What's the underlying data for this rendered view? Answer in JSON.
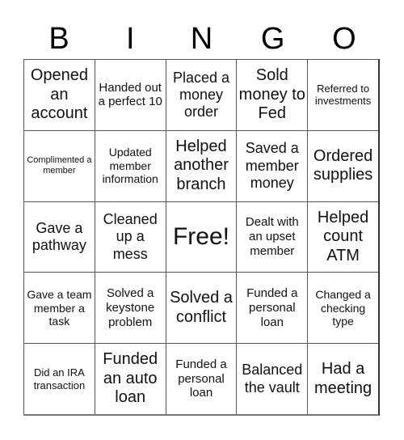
{
  "header": [
    "B",
    "I",
    "N",
    "G",
    "O"
  ],
  "cells": [
    "Opened an account",
    "Handed out a perfect 10",
    "Placed a money order",
    "Sold money to Fed",
    "Referred to investments",
    "Complimented a member",
    "Updated member information",
    "Helped another branch",
    "Saved a member money",
    "Ordered supplies",
    "Gave a pathway",
    "Cleaned up a mess",
    "Free!",
    "Dealt with an upset member",
    "Helped count ATM",
    "Gave a team member a task",
    "Solved a keystone problem",
    "Solved a conflict",
    "Funded a personal loan",
    "Changed a checking type",
    "Did an IRA transaction",
    "Funded an auto loan",
    "Funded a personal loan",
    "Balanced the vault",
    "Had a meeting"
  ]
}
